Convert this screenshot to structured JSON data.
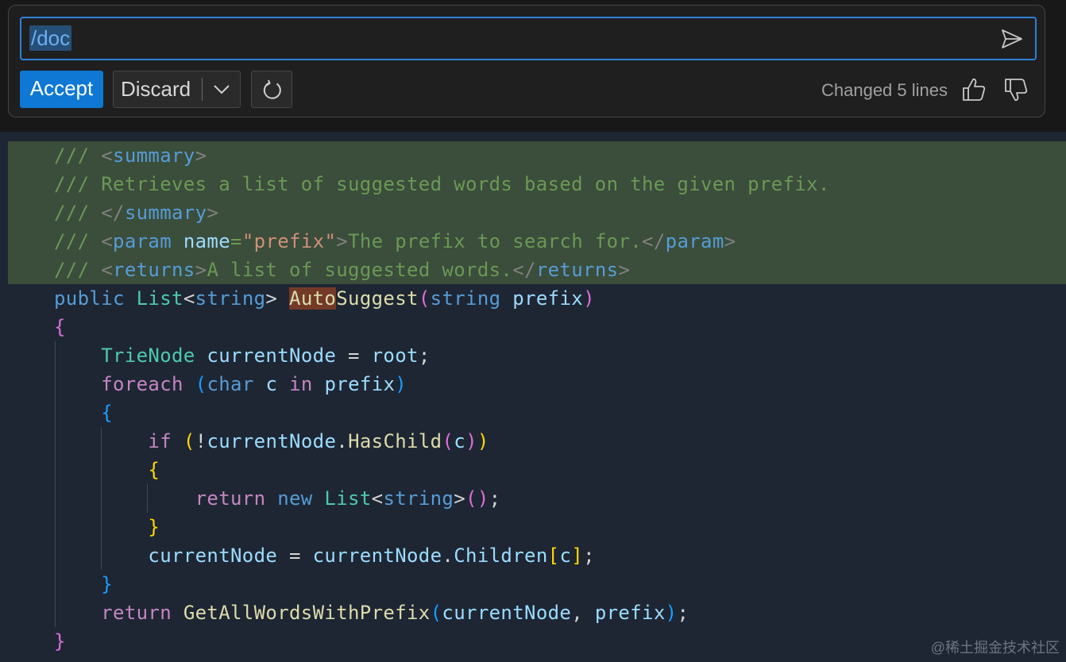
{
  "inline_chat": {
    "prompt_value": "/doc",
    "accept_label": "Accept",
    "discard_label": "Discard",
    "status_text": "Changed 5 lines",
    "icons": {
      "send": "send-icon",
      "discard_menu": "chevron-down-icon",
      "regenerate": "refresh-icon",
      "helpful": "thumbs-up-icon",
      "unhelpful": "thumbs-down-icon"
    }
  },
  "code": {
    "added_lines": 5,
    "colors": {
      "added_line_background": "#3b4d3b",
      "editor_background": "#1e2634",
      "accent": "#0e78d4"
    },
    "lines": [
      {
        "tokens": [
          [
            "c-com",
            "/// "
          ],
          [
            "c-punc",
            "<"
          ],
          [
            "c-tag",
            "summary"
          ],
          [
            "c-punc",
            ">"
          ]
        ]
      },
      {
        "tokens": [
          [
            "c-com",
            "/// Retrieves a list of suggested words based on the given prefix."
          ]
        ]
      },
      {
        "tokens": [
          [
            "c-com",
            "/// "
          ],
          [
            "c-punc",
            "</"
          ],
          [
            "c-tag",
            "summary"
          ],
          [
            "c-punc",
            ">"
          ]
        ]
      },
      {
        "tokens": [
          [
            "c-com",
            "/// "
          ],
          [
            "c-punc",
            "<"
          ],
          [
            "c-tag",
            "param"
          ],
          [
            "c-com",
            " "
          ],
          [
            "c-attr",
            "name"
          ],
          [
            "c-com",
            "="
          ],
          [
            "c-str",
            "\"prefix\""
          ],
          [
            "c-punc",
            ">"
          ],
          [
            "c-com",
            "The prefix to search for."
          ],
          [
            "c-punc",
            "</"
          ],
          [
            "c-tag",
            "param"
          ],
          [
            "c-punc",
            ">"
          ]
        ]
      },
      {
        "tokens": [
          [
            "c-com",
            "/// "
          ],
          [
            "c-punc",
            "<"
          ],
          [
            "c-tag",
            "returns"
          ],
          [
            "c-punc",
            ">"
          ],
          [
            "c-com",
            "A list of suggested words."
          ],
          [
            "c-punc",
            "</"
          ],
          [
            "c-tag",
            "returns"
          ],
          [
            "c-punc",
            ">"
          ]
        ]
      },
      {
        "tokens": [
          [
            "c-kw",
            "public"
          ],
          [
            "c-op",
            " "
          ],
          [
            "c-type",
            "List"
          ],
          [
            "c-op",
            "<"
          ],
          [
            "c-kw",
            "string"
          ],
          [
            "c-op",
            "> "
          ],
          [
            "c-fn hl",
            "Auto"
          ],
          [
            "c-fn",
            "Suggest"
          ],
          [
            "b2",
            "("
          ],
          [
            "c-kw",
            "string"
          ],
          [
            "c-op",
            " "
          ],
          [
            "c-var",
            "prefix"
          ],
          [
            "b2",
            ")"
          ]
        ]
      },
      {
        "tokens": [
          [
            "b2",
            "{"
          ]
        ]
      },
      {
        "tokens": [
          [
            "c-op",
            "    "
          ],
          [
            "c-type",
            "TrieNode"
          ],
          [
            "c-op",
            " "
          ],
          [
            "c-var",
            "currentNode"
          ],
          [
            "c-op",
            " = "
          ],
          [
            "c-var",
            "root"
          ],
          [
            "c-op",
            ";"
          ]
        ]
      },
      {
        "tokens": [
          [
            "c-op",
            "    "
          ],
          [
            "c-ctl",
            "foreach"
          ],
          [
            "c-op",
            " "
          ],
          [
            "b3",
            "("
          ],
          [
            "c-kw",
            "char"
          ],
          [
            "c-op",
            " "
          ],
          [
            "c-var",
            "c"
          ],
          [
            "c-op",
            " "
          ],
          [
            "c-ctl",
            "in"
          ],
          [
            "c-op",
            " "
          ],
          [
            "c-var",
            "prefix"
          ],
          [
            "b3",
            ")"
          ]
        ]
      },
      {
        "tokens": [
          [
            "c-op",
            "    "
          ],
          [
            "b3",
            "{"
          ]
        ]
      },
      {
        "tokens": [
          [
            "c-op",
            "        "
          ],
          [
            "c-ctl",
            "if"
          ],
          [
            "c-op",
            " "
          ],
          [
            "b1",
            "("
          ],
          [
            "c-op",
            "!"
          ],
          [
            "c-var",
            "currentNode"
          ],
          [
            "c-op",
            "."
          ],
          [
            "c-fn",
            "HasChild"
          ],
          [
            "b2",
            "("
          ],
          [
            "c-var",
            "c"
          ],
          [
            "b2",
            ")"
          ],
          [
            "b1",
            ")"
          ]
        ]
      },
      {
        "tokens": [
          [
            "c-op",
            "        "
          ],
          [
            "b1",
            "{"
          ]
        ]
      },
      {
        "tokens": [
          [
            "c-op",
            "            "
          ],
          [
            "c-ctl",
            "return"
          ],
          [
            "c-op",
            " "
          ],
          [
            "c-kw",
            "new"
          ],
          [
            "c-op",
            " "
          ],
          [
            "c-type",
            "List"
          ],
          [
            "c-op",
            "<"
          ],
          [
            "c-kw",
            "string"
          ],
          [
            "c-op",
            ">"
          ],
          [
            "b2",
            "("
          ],
          [
            "b2",
            ")"
          ],
          [
            "c-op",
            ";"
          ]
        ]
      },
      {
        "tokens": [
          [
            "c-op",
            "        "
          ],
          [
            "b1",
            "}"
          ]
        ]
      },
      {
        "tokens": [
          [
            "c-op",
            "        "
          ],
          [
            "c-var",
            "currentNode"
          ],
          [
            "c-op",
            " = "
          ],
          [
            "c-var",
            "currentNode"
          ],
          [
            "c-op",
            "."
          ],
          [
            "c-var",
            "Children"
          ],
          [
            "b1",
            "["
          ],
          [
            "c-var",
            "c"
          ],
          [
            "b1",
            "]"
          ],
          [
            "c-op",
            ";"
          ]
        ]
      },
      {
        "tokens": [
          [
            "c-op",
            "    "
          ],
          [
            "b3",
            "}"
          ]
        ]
      },
      {
        "tokens": [
          [
            "c-op",
            "    "
          ],
          [
            "c-ctl",
            "return"
          ],
          [
            "c-op",
            " "
          ],
          [
            "c-fn",
            "GetAllWordsWithPrefix"
          ],
          [
            "b3",
            "("
          ],
          [
            "c-var",
            "currentNode"
          ],
          [
            "c-op",
            ", "
          ],
          [
            "c-var",
            "prefix"
          ],
          [
            "b3",
            ")"
          ],
          [
            "c-op",
            ";"
          ]
        ]
      },
      {
        "tokens": [
          [
            "b2",
            "}"
          ]
        ]
      }
    ]
  },
  "watermark": "@稀土掘金技术社区"
}
